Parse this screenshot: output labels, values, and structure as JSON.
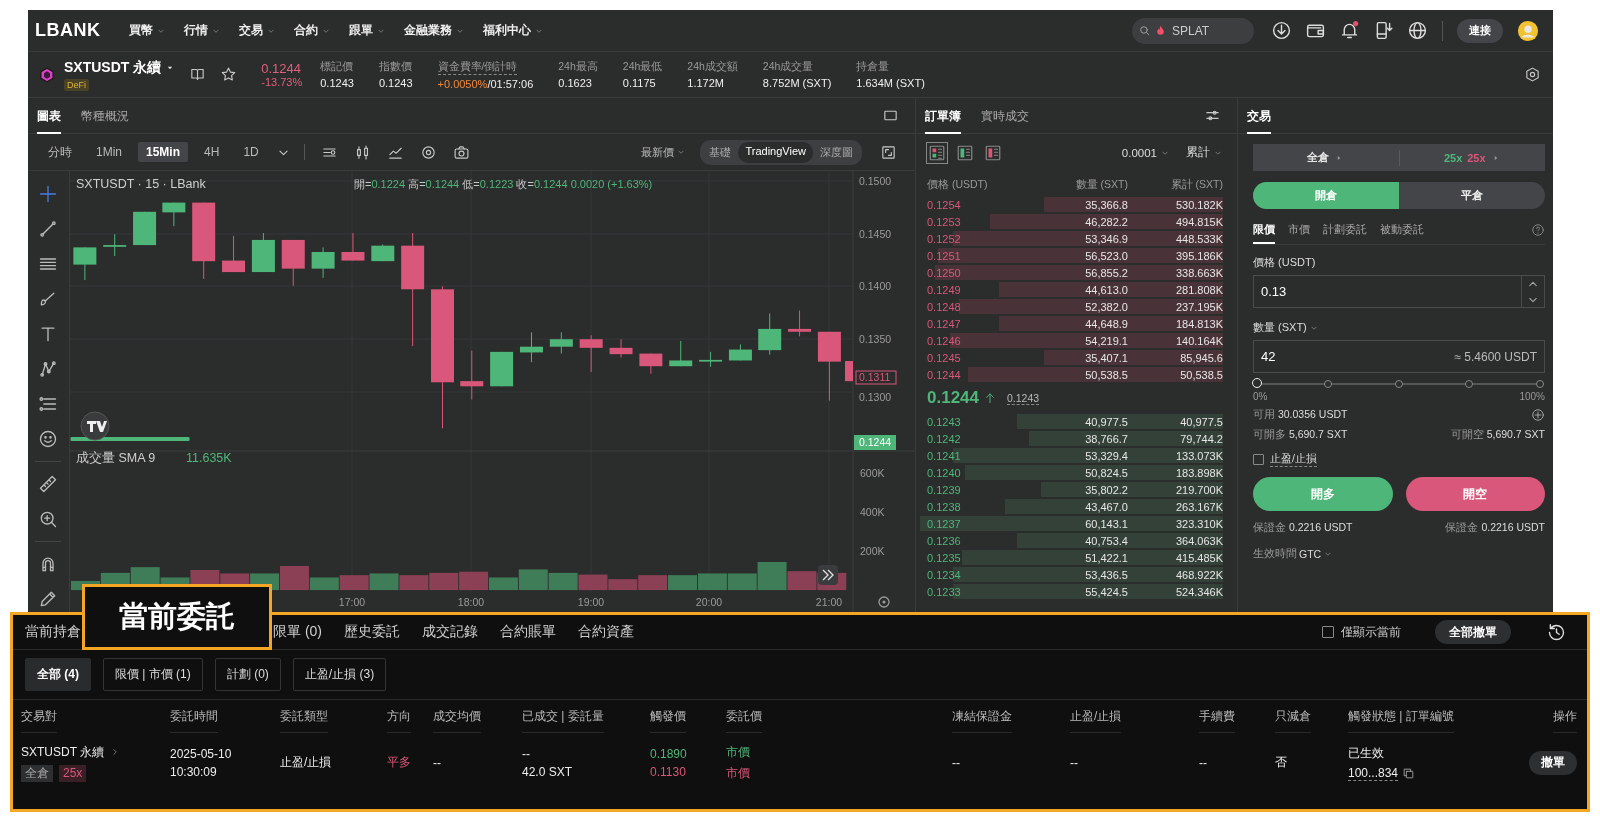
{
  "nav": {
    "logo": "LBANK",
    "menu": [
      {
        "label": "買幣"
      },
      {
        "label": "行情"
      },
      {
        "label": "交易"
      },
      {
        "label": "合約"
      },
      {
        "label": "跟單"
      },
      {
        "label": "金融業務"
      },
      {
        "label": "福利中心"
      }
    ],
    "search": {
      "placeholder": "SPLAT"
    },
    "connect": "連接"
  },
  "ticker": {
    "symbol": "SXTUSDT 永續",
    "tag": "DeFi",
    "price": "0.1244",
    "change": "-13.73%",
    "stats": [
      {
        "label": "標記價",
        "value": "0.1243",
        "kind": "plain"
      },
      {
        "label": "指數價",
        "value": "0.1243",
        "kind": "plain"
      },
      {
        "label": "資金費率/倒計時",
        "value": "+0.0050%",
        "extra": "/01:57:06",
        "kind": "funding"
      },
      {
        "label": "24h最高",
        "value": "0.1623",
        "kind": "plain"
      },
      {
        "label": "24h最低",
        "value": "0.1175",
        "kind": "plain"
      },
      {
        "label": "24h成交額",
        "value": "1.172M",
        "kind": "plain"
      },
      {
        "label": "24h成交量",
        "value": "8.752M (SXT)",
        "kind": "plain"
      },
      {
        "label": "持倉量",
        "value": "1.634M (SXT)",
        "kind": "plain"
      }
    ]
  },
  "chart": {
    "tabs": [
      {
        "label": "圖表",
        "selected": true
      },
      {
        "label": "幣種概況",
        "selected": false
      }
    ],
    "intervals": [
      {
        "label": "分時",
        "selected": false
      },
      {
        "label": "1Min",
        "selected": false
      },
      {
        "label": "15Min",
        "selected": true
      },
      {
        "label": "4H",
        "selected": false
      },
      {
        "label": "1D",
        "selected": false
      }
    ],
    "price_type": "最新價",
    "views": [
      {
        "label": "基礎",
        "selected": false
      },
      {
        "label": "TradingView",
        "selected": true
      },
      {
        "label": "深度圖",
        "selected": false
      }
    ],
    "legend": {
      "title": "SXTUSDT · 15 · LBank",
      "ohlc": [
        {
          "label": "開=",
          "value": "0.1224"
        },
        {
          "label": "高=",
          "value": "0.1244"
        },
        {
          "label": "低=",
          "value": "0.1223"
        },
        {
          "label": "收=",
          "value": "0.1244"
        }
      ],
      "change": "0.0020 (+1.63%)"
    },
    "price_axis": [
      "0.1500",
      "0.1450",
      "0.1400",
      "0.1350",
      "0.1300"
    ],
    "marker_tag": "0.1311",
    "last_tag": "0.1244",
    "volume_legend": {
      "label": "成交量 SMA 9",
      "value": "11.635K"
    },
    "volume_axis": [
      "600K",
      "400K",
      "200K"
    ],
    "time_axis": [
      "17:00",
      "18:00",
      "19:00",
      "20:00",
      "21:00"
    ]
  },
  "order_book": {
    "tabs": [
      {
        "label": "訂單簿",
        "selected": true
      },
      {
        "label": "實時成交",
        "selected": false
      }
    ],
    "layouts": [
      {
        "kind": "both",
        "selected": true
      },
      {
        "kind": "bids",
        "selected": false
      },
      {
        "kind": "asks",
        "selected": false
      }
    ],
    "precision": "0.0001",
    "mode": "累計",
    "columns": [
      "價格 (USDT)",
      "數量 (SXT)",
      "累計 (SXT)"
    ],
    "asks": [
      {
        "price": "0.1254",
        "qty": "35,366.8",
        "total": "530.182K"
      },
      {
        "price": "0.1253",
        "qty": "46,282.2",
        "total": "494.815K"
      },
      {
        "price": "0.1252",
        "qty": "53,346.9",
        "total": "448.533K"
      },
      {
        "price": "0.1251",
        "qty": "56,523.0",
        "total": "395.186K"
      },
      {
        "price": "0.1250",
        "qty": "56,855.2",
        "total": "338.663K"
      },
      {
        "price": "0.1249",
        "qty": "44,613.0",
        "total": "281.808K"
      },
      {
        "price": "0.1248",
        "qty": "52,382.0",
        "total": "237.195K"
      },
      {
        "price": "0.1247",
        "qty": "44,648.9",
        "total": "184.813K"
      },
      {
        "price": "0.1246",
        "qty": "54,219.1",
        "total": "140.164K"
      },
      {
        "price": "0.1245",
        "qty": "35,407.1",
        "total": "85,945.6"
      },
      {
        "price": "0.1244",
        "qty": "50,538.5",
        "total": "50,538.5"
      }
    ],
    "last": {
      "price": "0.1244",
      "mark": "0.1243"
    },
    "bids": [
      {
        "price": "0.1243",
        "qty": "40,977.5",
        "total": "40,977.5"
      },
      {
        "price": "0.1242",
        "qty": "38,766.7",
        "total": "79,744.2"
      },
      {
        "price": "0.1241",
        "qty": "53,329.4",
        "total": "133.073K"
      },
      {
        "price": "0.1240",
        "qty": "50,824.5",
        "total": "183.898K"
      },
      {
        "price": "0.1239",
        "qty": "35,802.2",
        "total": "219.700K"
      },
      {
        "price": "0.1238",
        "qty": "43,467.0",
        "total": "263.167K"
      },
      {
        "price": "0.1237",
        "qty": "60,143.1",
        "total": "323.310K"
      },
      {
        "price": "0.1236",
        "qty": "40,753.4",
        "total": "364.063K"
      },
      {
        "price": "0.1235",
        "qty": "51,422.1",
        "total": "415.485K"
      },
      {
        "price": "0.1234",
        "qty": "53,436.5",
        "total": "468.922K"
      },
      {
        "price": "0.1233",
        "qty": "55,424.5",
        "total": "524.346K"
      }
    ]
  },
  "trade": {
    "title": "交易",
    "margin_mode": "全倉",
    "leverage": {
      "long": "25x",
      "short": "25x"
    },
    "position_tabs": [
      {
        "label": "開倉",
        "selected": true
      },
      {
        "label": "平倉",
        "selected": false
      }
    ],
    "order_types": [
      {
        "label": "限價",
        "selected": true
      },
      {
        "label": "市價",
        "selected": false
      },
      {
        "label": "計劃委託",
        "selected": false
      },
      {
        "label": "被動委託",
        "selected": false
      }
    ],
    "price": {
      "label": "價格 (USDT)",
      "value": "0.13"
    },
    "amount": {
      "label": "數量 (SXT)",
      "value": "42",
      "estimate": "≈ 5.4600 USDT"
    },
    "slider": {
      "level": 0,
      "min_label": "0%",
      "max_label": "100%"
    },
    "available": {
      "label": "可用",
      "value": "30.0356 USDT"
    },
    "max_open": [
      {
        "label": "可開多",
        "value": "5,690.7 SXT"
      },
      {
        "label": "可開空",
        "value": "5,690.7 SXT"
      }
    ],
    "tpsl": {
      "label": "止盈/止損",
      "checked": false
    },
    "buttons": [
      {
        "label": "開多",
        "kind": "long"
      },
      {
        "label": "開空",
        "kind": "short"
      }
    ],
    "margins": [
      {
        "label": "保證金",
        "value": "0.2216 USDT"
      },
      {
        "label": "保證金",
        "value": "0.2216 USDT"
      }
    ],
    "validity": {
      "label": "生效時間",
      "value": "GTC"
    }
  },
  "orders": {
    "callout": "當前委託",
    "tabs": [
      {
        "label": "當前持倉",
        "selected": false
      },
      {
        "label": "限單 (0)",
        "selected": false
      },
      {
        "label": "歷史委託",
        "selected": false
      },
      {
        "label": "成交記錄",
        "selected": false
      },
      {
        "label": "合約賬單",
        "selected": false
      },
      {
        "label": "合約資產",
        "selected": false
      }
    ],
    "only_current": {
      "label": "僅顯示當前",
      "checked": false
    },
    "cancel_all": "全部撤單",
    "filters": [
      {
        "label": "全部 (4)",
        "selected": true
      },
      {
        "label": "限價 | 市價 (1)",
        "selected": false
      },
      {
        "label": "計劃 (0)",
        "selected": false
      },
      {
        "label": "止盈/止損 (3)",
        "selected": false
      }
    ],
    "columns": [
      "交易對",
      "委託時間",
      "委託類型",
      "方向",
      "成交均價",
      "已成交 | 委託量",
      "觸發價",
      "委託價",
      "凍結保證金",
      "止盈/止損",
      "手續費",
      "只減倉",
      "觸發狀態 | 訂單編號",
      "操作"
    ],
    "rows": [
      {
        "pair": "SXTUSDT 永續",
        "margin_tag": "全倉",
        "leverage_tag": "25x",
        "time": [
          "2025-05-10",
          "10:30:09"
        ],
        "type": "止盈/止損",
        "direction": {
          "text": "平多",
          "kind": "down"
        },
        "avg_price": "--",
        "filled": [
          "--",
          "42.0 SXT"
        ],
        "trigger": [
          {
            "text": "0.1890",
            "kind": "up"
          },
          {
            "text": "0.1130",
            "kind": "down"
          }
        ],
        "order_price": [
          {
            "text": "市價",
            "kind": "up"
          },
          {
            "text": "市價",
            "kind": "down"
          }
        ],
        "frozen": "--",
        "tpsl": "--",
        "fee": "--",
        "reduce_only": "否",
        "status": "已生效",
        "order_id": "100...834",
        "action": "撤單"
      }
    ]
  }
}
